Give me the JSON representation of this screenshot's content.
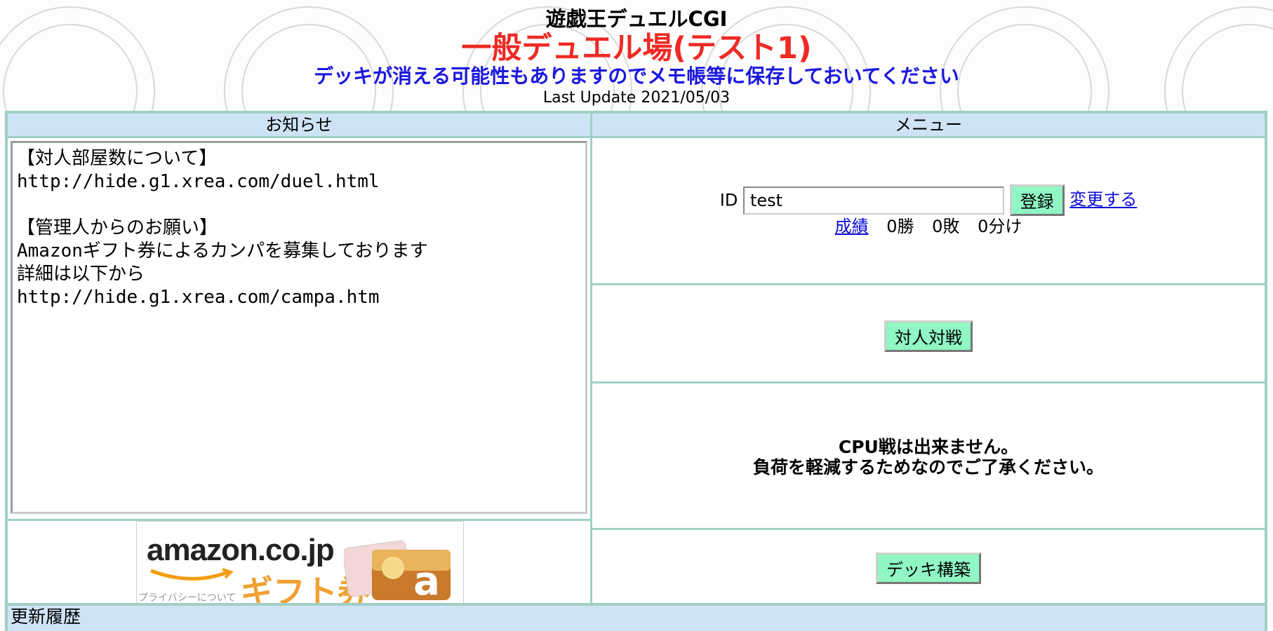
{
  "header": {
    "app_title": "遊戯王デュエルCGI",
    "room_title": "一般デュエル場(テスト1)",
    "warning": "デッキが消える可能性もありますのでメモ帳等に保存しておいてください",
    "last_update": "Last Update 2021/05/03"
  },
  "notice": {
    "heading": "お知らせ",
    "body": "【対人部屋数について】\nhttp://hide.g1.xrea.com/duel.html\n\n【管理人からのお願い】\nAmazonギフト券によるカンパを募集しております\n詳細は以下から\nhttp://hide.g1.xrea.com/campa.htm"
  },
  "banner": {
    "brand": "amazon.co.jp",
    "gift_text": "ギフト券",
    "privacy": "プライバシーについて"
  },
  "menu": {
    "heading": "メニュー",
    "id_label": "ID",
    "id_value": "test",
    "register_button": "登録",
    "change_link": "変更する",
    "record_link": "成績",
    "wins": "0勝",
    "losses": "0敗",
    "draws": "0分け",
    "pvp_button": "対人対戦",
    "cpu_line1": "CPU戦は出来ません。",
    "cpu_line2": "負荷を軽減するためなのでご了承ください。",
    "deck_button": "デッキ構築"
  },
  "history": {
    "heading": "更新履歴"
  },
  "colors": {
    "border": "#9fd0c6",
    "header_bg": "#cfe3f6",
    "button_bg": "#8ff6c4",
    "title_red": "#ee2a24",
    "warning_blue": "#1a17e0",
    "link_blue": "#0a0adb"
  }
}
